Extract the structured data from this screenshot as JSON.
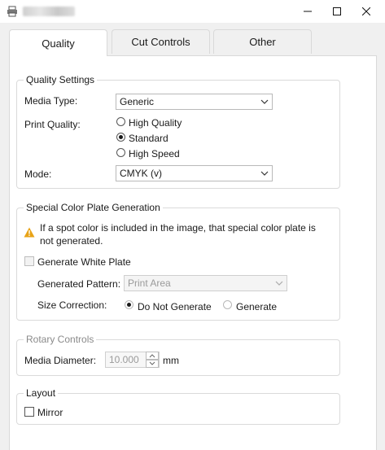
{
  "window": {
    "title": "",
    "controls": {
      "minimize": "—",
      "maximize": "☐",
      "close": "✕"
    }
  },
  "tabs": [
    {
      "label": "Quality",
      "active": true
    },
    {
      "label": "Cut Controls",
      "active": false
    },
    {
      "label": "Other",
      "active": false
    }
  ],
  "quality_settings": {
    "title": "Quality Settings",
    "media_type_label": "Media Type:",
    "media_type_value": "Generic",
    "print_quality_label": "Print Quality:",
    "print_quality_options": [
      {
        "label": "High Quality",
        "checked": false
      },
      {
        "label": "Standard",
        "checked": true
      },
      {
        "label": "High Speed",
        "checked": false
      }
    ],
    "mode_label": "Mode:",
    "mode_value": "CMYK (v)"
  },
  "special_color": {
    "title": "Special Color Plate Generation",
    "warning_line1": "If a spot color is included in the image, that special color plate is",
    "warning_line2": "not generated.",
    "generate_white_plate_label": "Generate White Plate",
    "generated_pattern_label": "Generated Pattern:",
    "generated_pattern_value": "Print Area",
    "size_correction_label": "Size Correction:",
    "size_correction_options": [
      {
        "label": "Do Not Generate",
        "checked": true
      },
      {
        "label": "Generate",
        "checked": false
      }
    ]
  },
  "rotary_controls": {
    "title": "Rotary Controls",
    "media_diameter_label": "Media Diameter:",
    "media_diameter_value": "10.000",
    "unit": "mm"
  },
  "layout": {
    "title": "Layout",
    "mirror_label": "Mirror"
  },
  "colors": {
    "window_bg": "#f0f0f0",
    "panel_bg": "#ffffff",
    "border": "#d9d9d9",
    "warning": "#e8a317",
    "disabled_text": "#8a8a8a"
  }
}
